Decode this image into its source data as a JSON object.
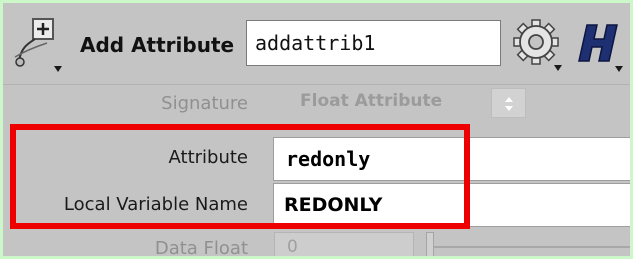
{
  "header": {
    "node_type_label": "Add Attribute",
    "node_name": "addattrib1",
    "node_icon": "add-attribute-icon",
    "gear_icon": "gear-icon",
    "help_icon": "houdini-help-icon"
  },
  "params": {
    "signature": {
      "label": "Signature",
      "value": "Float Attribute"
    },
    "attribute": {
      "label": "Attribute",
      "value": "redonly"
    },
    "local_variable": {
      "label": "Local Variable Name",
      "value": "REDONLY"
    },
    "data_float": {
      "label": "Data Float",
      "value": "0"
    }
  },
  "colors": {
    "background": "#cbf7c9",
    "panel": "#c4c4c4",
    "highlight": "#ee0000",
    "help_blue": "#1e2f72"
  }
}
